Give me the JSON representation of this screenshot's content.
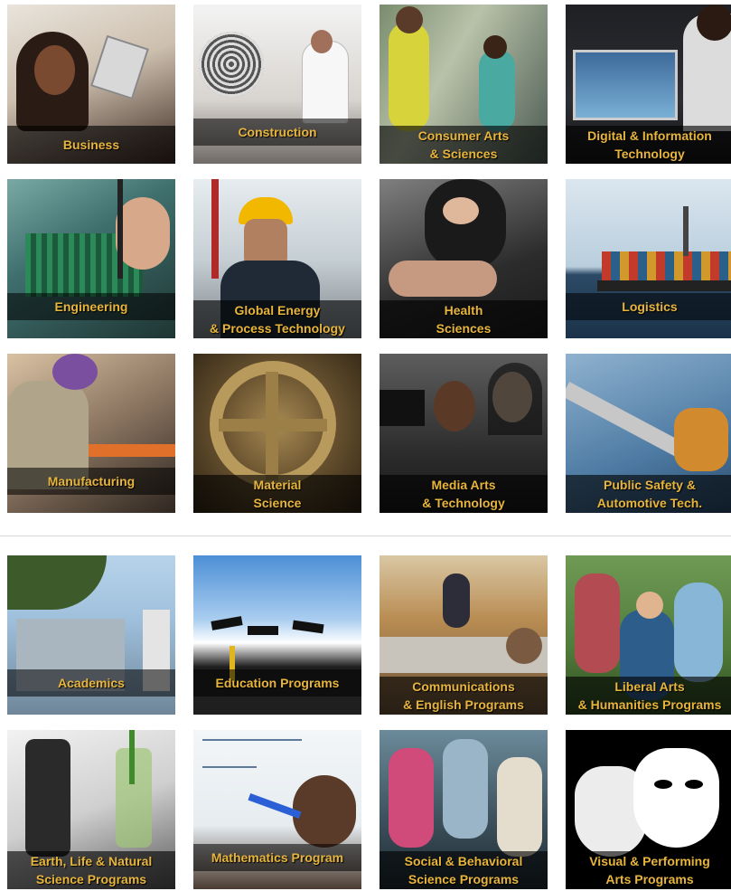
{
  "career_tiles": [
    {
      "lines": [
        "Business"
      ],
      "icon": "business-photo"
    },
    {
      "lines": [
        "Construction"
      ],
      "icon": "construction-photo"
    },
    {
      "lines": [
        "Consumer Arts",
        "& Sciences"
      ],
      "icon": "consumer-arts-photo"
    },
    {
      "lines": [
        "Digital & Information",
        "Technology"
      ],
      "icon": "digital-technology-photo"
    },
    {
      "lines": [
        "Engineering"
      ],
      "icon": "engineering-photo"
    },
    {
      "lines": [
        "Global Energy",
        "& Process Technology"
      ],
      "icon": "global-energy-photo"
    },
    {
      "lines": [
        "Health",
        "Sciences"
      ],
      "icon": "health-sciences-photo"
    },
    {
      "lines": [
        "Logistics"
      ],
      "icon": "logistics-photo"
    },
    {
      "lines": [
        "Manufacturing"
      ],
      "icon": "manufacturing-photo"
    },
    {
      "lines": [
        "Material",
        "Science"
      ],
      "icon": "material-science-photo"
    },
    {
      "lines": [
        "Media Arts",
        "& Technology"
      ],
      "icon": "media-arts-photo"
    },
    {
      "lines": [
        "Public Safety &",
        "Automotive Tech."
      ],
      "icon": "public-safety-photo"
    }
  ],
  "academic_tiles": [
    {
      "lines": [
        "Academics"
      ],
      "icon": "academics-photo"
    },
    {
      "lines": [
        "Education Programs"
      ],
      "icon": "education-photo"
    },
    {
      "lines": [
        "Communications",
        "& English Programs"
      ],
      "icon": "communications-photo"
    },
    {
      "lines": [
        "Liberal Arts",
        "& Humanities Programs"
      ],
      "icon": "liberal-arts-photo"
    },
    {
      "lines": [
        "Earth, Life & Natural",
        "Science Programs"
      ],
      "icon": "natural-science-photo"
    },
    {
      "lines": [
        "Mathematics Program"
      ],
      "icon": "mathematics-photo"
    },
    {
      "lines": [
        "Social & Behavioral",
        "Science Programs"
      ],
      "icon": "social-science-photo"
    },
    {
      "lines": [
        "Visual & Performing",
        "Arts Programs"
      ],
      "icon": "performing-arts-photo"
    }
  ],
  "colors": {
    "caption_text": "#e8b53c",
    "caption_bg": "#000000",
    "divider": "#d6d6d6"
  }
}
